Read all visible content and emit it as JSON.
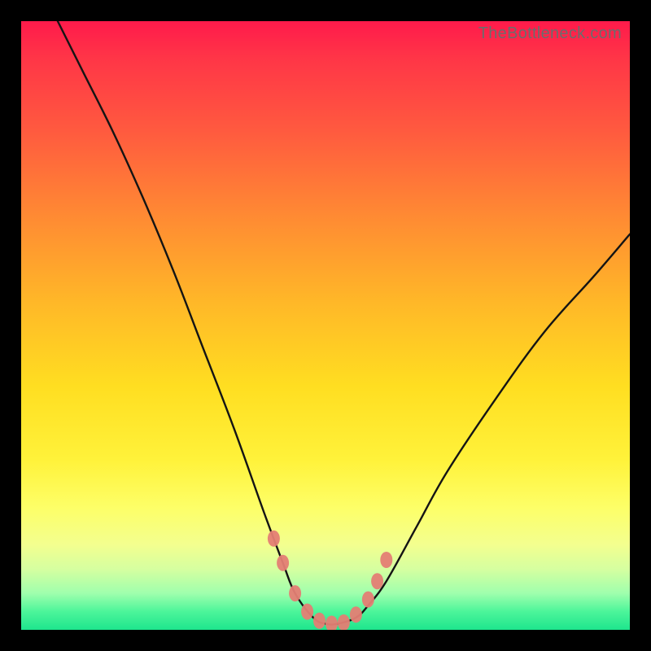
{
  "watermark": "TheBottleneck.com",
  "chart_data": {
    "type": "line",
    "title": "",
    "xlabel": "",
    "ylabel": "",
    "xlim": [
      0,
      100
    ],
    "ylim": [
      0,
      100
    ],
    "gradient_description": "vertical red-to-green heat gradient (bottleneck severity)",
    "series": [
      {
        "name": "bottleneck-curve",
        "x": [
          6,
          10,
          15,
          20,
          25,
          30,
          35,
          40,
          43,
          45,
          48,
          50,
          52,
          55,
          57,
          60,
          65,
          70,
          78,
          86,
          94,
          100
        ],
        "y": [
          100,
          92,
          82,
          71,
          59,
          46,
          33,
          19,
          11,
          6,
          2,
          1,
          1,
          2,
          4,
          8,
          17,
          26,
          38,
          49,
          58,
          65
        ]
      }
    ],
    "markers": {
      "name": "sweet-spot-band",
      "points_xy": [
        [
          41.5,
          15
        ],
        [
          43,
          11
        ],
        [
          45,
          6
        ],
        [
          47,
          3
        ],
        [
          49,
          1.5
        ],
        [
          51,
          1
        ],
        [
          53,
          1.2
        ],
        [
          55,
          2.5
        ],
        [
          57,
          5
        ],
        [
          58.5,
          8
        ],
        [
          60,
          11.5
        ]
      ]
    }
  }
}
